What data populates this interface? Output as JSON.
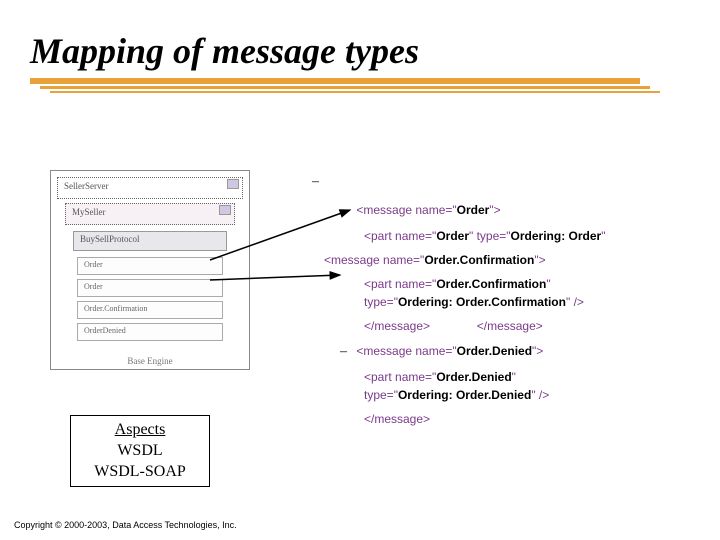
{
  "title": "Mapping of message types",
  "diagram": {
    "outer": "SellerServer",
    "mid": "MySeller",
    "proto": "BuySellProtocol",
    "rows": [
      "Order",
      "Order",
      "Order.Confirmation",
      "OrderDenied"
    ],
    "caption": "Base Engine"
  },
  "code": {
    "l1_pre": "<message name=\"",
    "l1_b": "Order",
    "l1_post": "\">",
    "l2_pre": "<part name=\"",
    "l2_b1": "Order",
    "l2_mid": "\" type=\"",
    "l2_b2": "Ordering: Order",
    "l2_post": "\"",
    "l3_pre": "<message name=\"",
    "l3_b": "Order.Confirmation",
    "l3_post": "\">",
    "l4_pre": "<part name=\"",
    "l4_b": "Order.Confirmation",
    "l4_post": "\"",
    "l5_pre": "type=\"",
    "l5_b": "Ordering: Order.Confirmation",
    "l5_post": "\" />",
    "l6a": "</message>",
    "l6b": "</message>",
    "l7_pre": "<message name=\"",
    "l7_b": "Order.Denied",
    "l7_post": "\">",
    "l8_pre": "<part name=\"",
    "l8_b": "Order.Denied",
    "l8_post": "\"",
    "l9_pre": "type=\"",
    "l9_b": "Ordering: Order.Denied",
    "l9_post": "\" />",
    "l10": "</message>"
  },
  "aspects": {
    "l1": "Aspects",
    "l2": "WSDL",
    "l3": "WSDL-SOAP"
  },
  "copyright": "Copyright © 2000-2003, Data Access Technologies, Inc."
}
